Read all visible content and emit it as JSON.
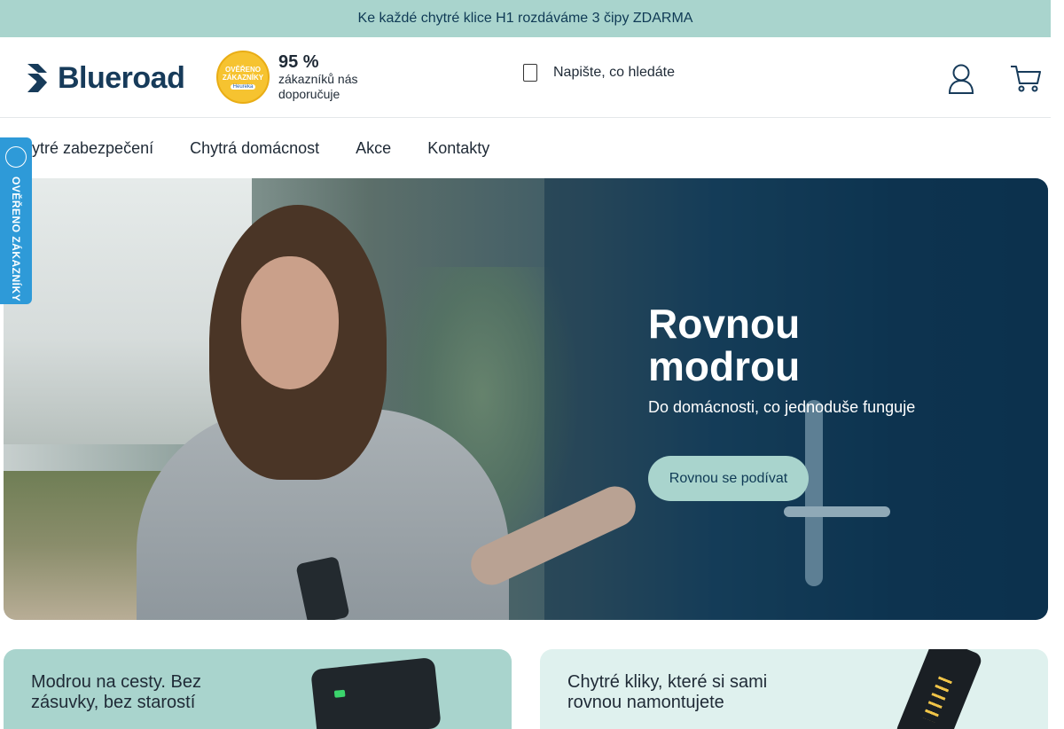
{
  "promo_bar": {
    "text": "Ke každé chytré klice H1 rozdáváme 3 čipy ZDARMA"
  },
  "header": {
    "logo_text": "Blueroad",
    "badge": {
      "line1": "OVĚŘENO",
      "line2": "ZÁKAZNÍKY",
      "brand": "Heureka"
    },
    "rating": {
      "percent": "95 %",
      "text": "zákazníků nás doporučuje"
    },
    "search": {
      "placeholder": "Napište, co hledáte"
    },
    "icons": {
      "search": "search-icon",
      "account": "user-icon",
      "cart": "cart-icon"
    }
  },
  "nav": {
    "items": [
      {
        "label": "hytré zabezpečení"
      },
      {
        "label": "Chytrá domácnost"
      },
      {
        "label": "Akce"
      },
      {
        "label": "Kontakty"
      }
    ]
  },
  "side_badge": {
    "text": "OVĚŘENO ZÁKAZNÍKY"
  },
  "hero": {
    "title": "Rovnou modrou",
    "subtitle": "Do domácnosti, co jednoduše funguje",
    "button_label": "Rovnou se podívat"
  },
  "cards": [
    {
      "text": "Modrou na cesty. Bez zásuvky, bez starostí"
    },
    {
      "text": "Chytré kliky, které si sami rovnou namontujete"
    }
  ],
  "colors": {
    "accent": "#a9d4cd",
    "brand_dark": "#173b5a",
    "side_badge": "#2e9ad8",
    "card_light": "#dff1ee"
  }
}
